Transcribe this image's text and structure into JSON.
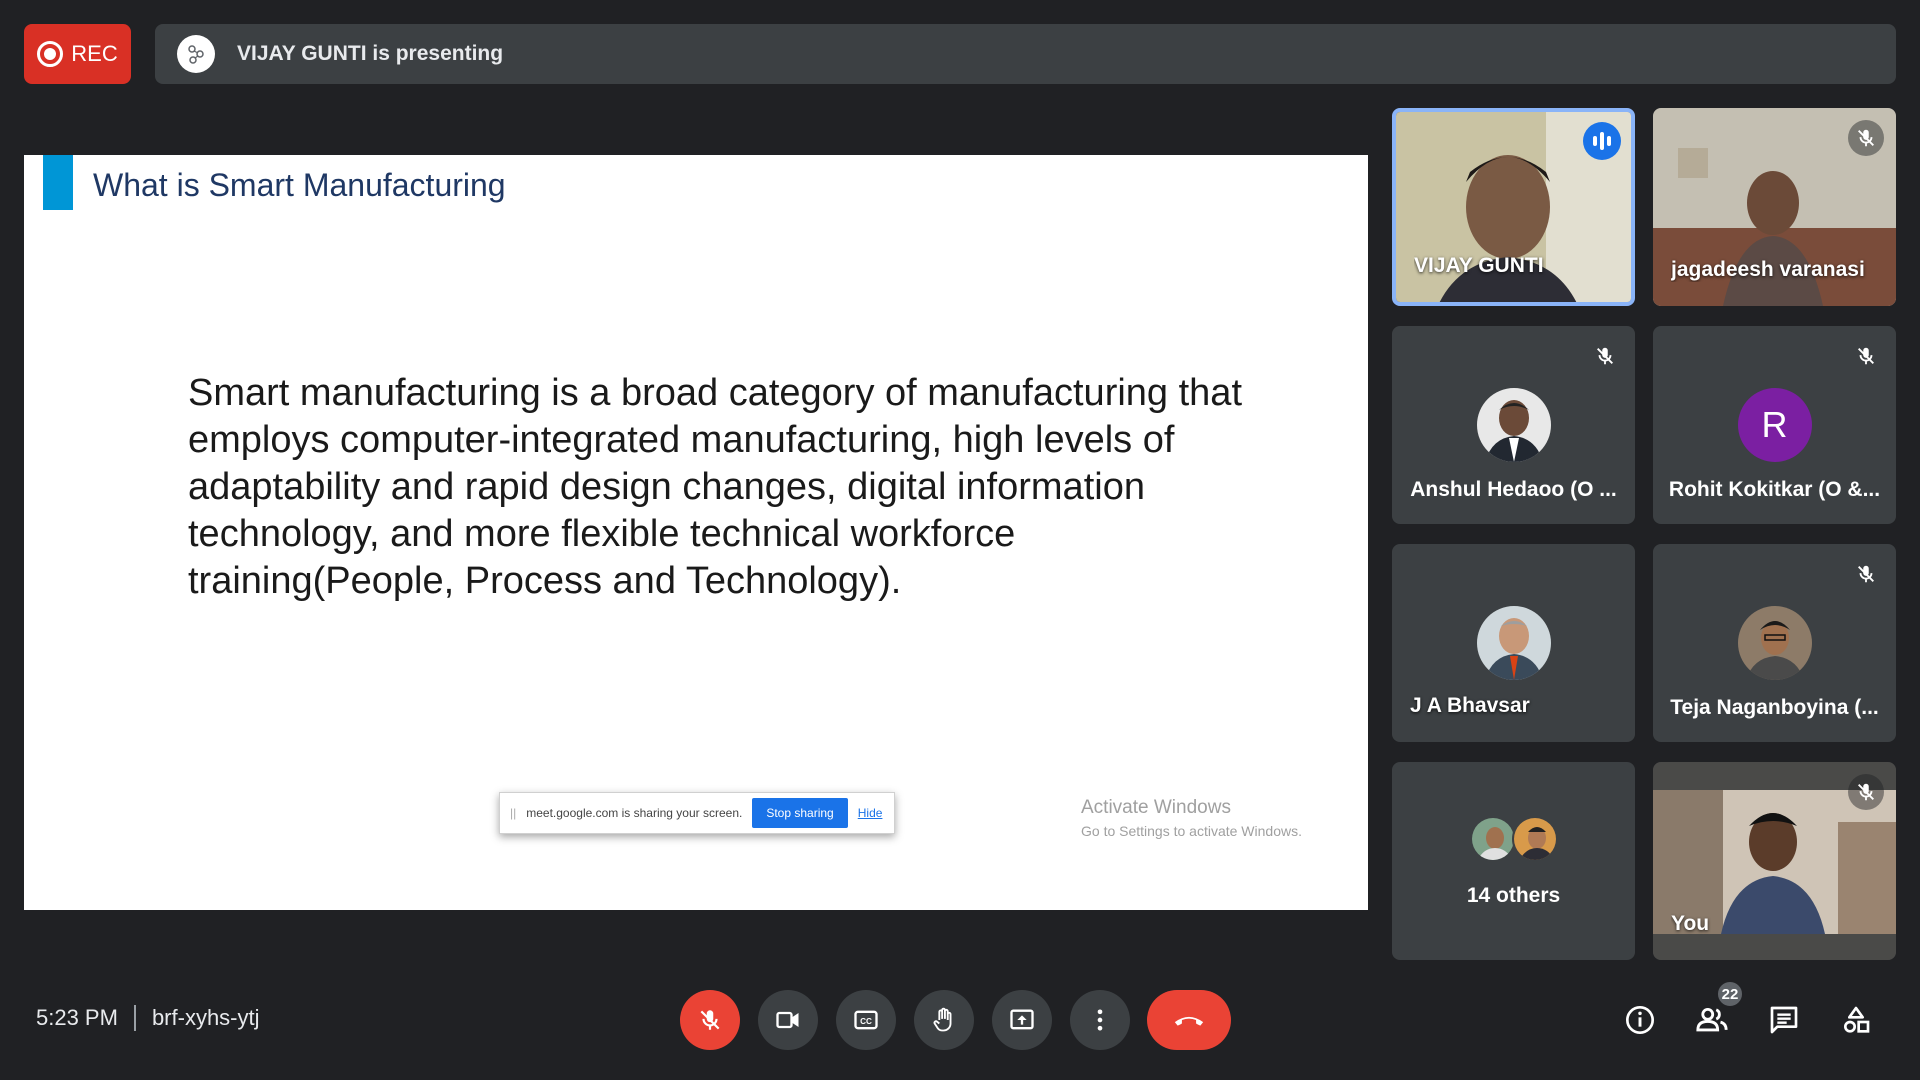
{
  "top_bar": {
    "rec_label": "REC",
    "presenting_text": "VIJAY GUNTI is presenting"
  },
  "slide": {
    "title": "What is Smart Manufacturing",
    "body": "Smart manufacturing is a broad category of manufacturing that employs computer-integrated manufacturing, high levels of adaptability and rapid design changes, digital information technology, and more flexible technical workforce training(People, Process and Technology).",
    "share_text": "meet.google.com is sharing your screen.",
    "stop_sharing": "Stop sharing",
    "hide": "Hide",
    "activate_title": "Activate Windows",
    "activate_sub": "Go to Settings to activate Windows."
  },
  "participants": [
    {
      "name": "VIJAY GUNTI",
      "speaking": true
    },
    {
      "name": "jagadeesh varanasi",
      "muted": true
    },
    {
      "name": "Anshul Hedaoo (O ...",
      "muted": true
    },
    {
      "name": "Rohit Kokitkar (O &...",
      "muted": true,
      "initial": "R"
    },
    {
      "name": "J A Bhavsar",
      "muted": false
    },
    {
      "name": "Teja Naganboyina (...",
      "muted": true
    },
    {
      "name": "14 others"
    },
    {
      "name": "You",
      "muted": true
    }
  ],
  "bottom_bar": {
    "time": "5:23 PM",
    "meeting_code": "brf-xyhs-ytj",
    "participant_count": "22"
  },
  "colors": {
    "background": "#202124",
    "tile": "#3c4043",
    "rec": "#d93025",
    "end_call": "#ea4335",
    "speaking_border": "#8ab4f8"
  }
}
